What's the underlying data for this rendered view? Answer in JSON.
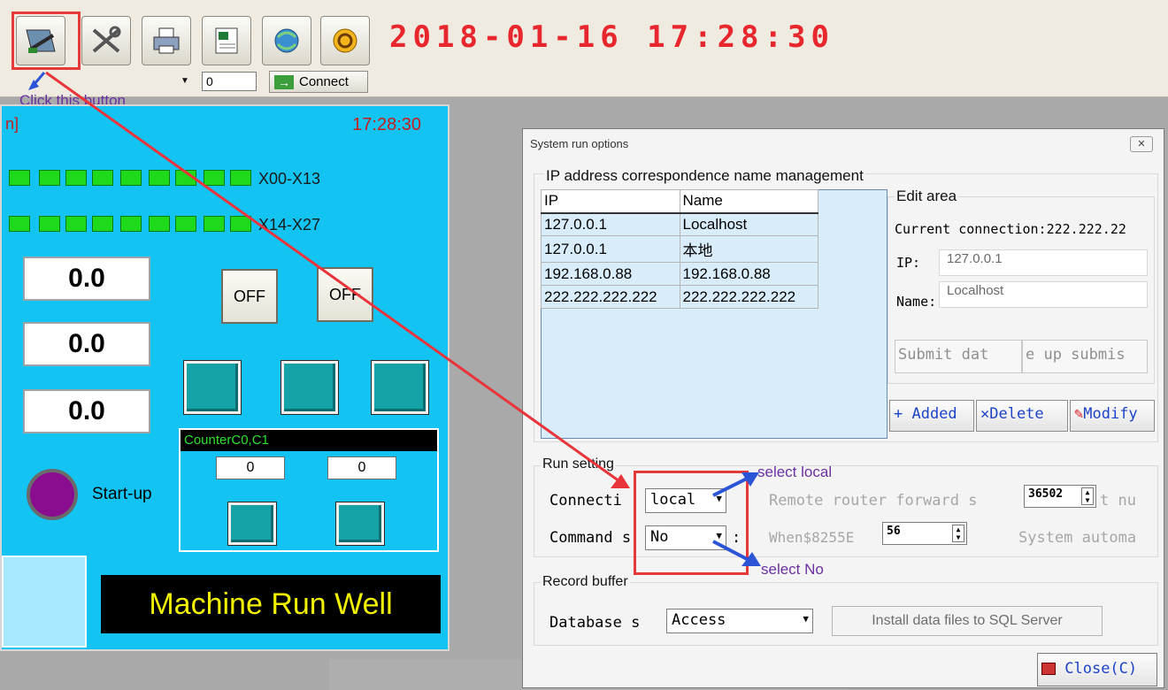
{
  "toolbar": {
    "buttons": [
      {
        "icon": "settings-tools-icon"
      },
      {
        "icon": "tools-icon"
      },
      {
        "icon": "printer-icon"
      },
      {
        "icon": "excel-icon"
      },
      {
        "icon": "network-icon"
      },
      {
        "icon": "exit-icon"
      }
    ],
    "datetime": "2018-01-16  17:28:30",
    "number_value": "0",
    "connect_label": "Connect"
  },
  "annotations": {
    "click_hint": "Click this button",
    "select_local": "select local",
    "select_no": "select No"
  },
  "hmi": {
    "title": "n]",
    "time": "17:28:30",
    "row1_label": "X00-X13",
    "row2_label": "X14-X27",
    "values": [
      "0.0",
      "0.0",
      "0.0"
    ],
    "off_labels": [
      "OFF",
      "OFF"
    ],
    "counter_title": "CounterC0,C1",
    "counter_values": [
      "0",
      "0"
    ],
    "startup_label": "Start-up",
    "status_text": "Machine Run Well"
  },
  "dialog": {
    "title": "System run options",
    "close_x": "✕",
    "ip_group_title": "IP address correspondence name management",
    "table": {
      "headers": [
        "IP",
        "Name"
      ],
      "rows": [
        [
          "127.0.0.1",
          "Localhost"
        ],
        [
          "127.0.0.1",
          "本地"
        ],
        [
          "192.168.0.88",
          "192.168.0.88"
        ],
        [
          "222.222.222.222",
          "222.222.222.222"
        ]
      ]
    },
    "edit_area": {
      "title": "Edit area",
      "current_connection": "Current connection:222.222.22",
      "ip_label": "IP:",
      "ip_value": "127.0.0.1",
      "name_label": "Name:",
      "name_value": "Localhost",
      "submit_label": "Submit dat",
      "update_label": "e up submis",
      "added_label": "+ Added",
      "delete_label": "✕Delete",
      "modify_label": "Modify"
    },
    "run_setting": {
      "title": "Run setting",
      "connection_label": "Connecti",
      "connection_value": "local",
      "command_label": "Command s",
      "command_value": "No",
      "command_colon": ":",
      "remote_label": "Remote router forward s",
      "port_value": "36502",
      "port_suffix": "t nu",
      "when_label": "When$8255E",
      "when_value": "56",
      "system_label": "System automa"
    },
    "record_buffer": {
      "title": "Record buffer",
      "database_label": "Database s",
      "database_value": "Access",
      "install_label": "Install data files to SQL Server"
    },
    "close_label": "Close(C)"
  }
}
